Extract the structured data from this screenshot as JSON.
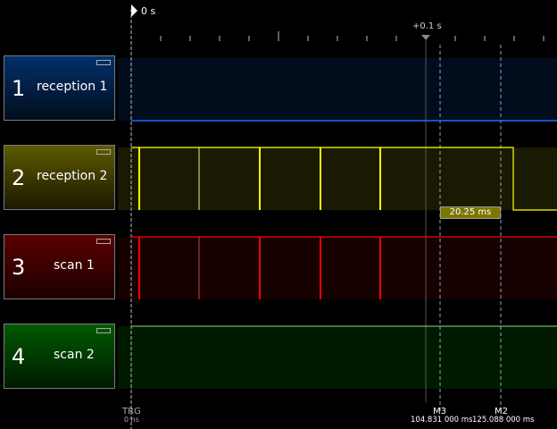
{
  "timebase": {
    "origin_label": "0 s",
    "marker_label": "+0.1 s"
  },
  "channels": [
    {
      "number": "1",
      "name": "reception 1",
      "color": "#1a6cff"
    },
    {
      "number": "2",
      "name": "reception 2",
      "color": "#ffff00"
    },
    {
      "number": "3",
      "name": "scan 1",
      "color": "#ff0000"
    },
    {
      "number": "4",
      "name": "scan 2",
      "color": "#00e000"
    }
  ],
  "measurement": {
    "delta": "20.25 ms"
  },
  "markers": {
    "trigger": {
      "label": "TRG",
      "time": "0 ns"
    },
    "m3": {
      "label": "M3",
      "time": "104.831 000 ms"
    },
    "m2": {
      "label": "M2",
      "time": "125.088 000 ms"
    }
  }
}
